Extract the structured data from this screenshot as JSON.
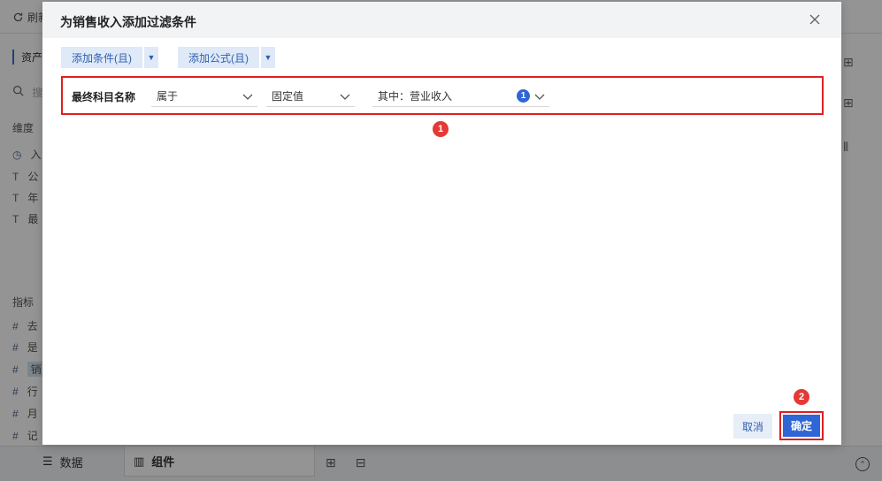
{
  "background": {
    "toolbar": {
      "refresh_label": "刷新"
    },
    "left_panel": {
      "title": "资产",
      "search_placeholder": "搜",
      "dimension_section": "维度",
      "dimension_items": [
        {
          "type_icon": "clock-icon",
          "label": "入"
        },
        {
          "type_icon": "text-type-icon",
          "label": "公"
        },
        {
          "type_icon": "text-type-icon",
          "label": "年"
        },
        {
          "type_icon": "text-type-icon",
          "label": "最"
        }
      ],
      "metric_section": "指标",
      "metric_items": [
        {
          "type_icon": "hash-icon",
          "label": "去"
        },
        {
          "type_icon": "hash-icon",
          "label": "是"
        },
        {
          "type_icon": "hash-icon",
          "label": "销"
        },
        {
          "type_icon": "hash-icon",
          "label": "行"
        },
        {
          "type_icon": "hash-icon",
          "label": "月"
        },
        {
          "type_icon": "hash-formula-icon",
          "label": "记"
        }
      ]
    },
    "bottom_tabs": [
      {
        "icon": "database-icon",
        "label": "数据"
      },
      {
        "icon": "component-icon",
        "label": "组件"
      }
    ]
  },
  "dialog": {
    "title": "为销售收入添加过滤条件",
    "add_condition_label": "添加条件(且)",
    "add_formula_label": "添加公式(且)",
    "condition": {
      "field": "最终科目名称",
      "operator": "属于",
      "value_type": "固定值",
      "value": "其中：营业收入",
      "value_count": "1"
    },
    "markers": [
      "1",
      "2"
    ],
    "cancel_label": "取消",
    "ok_label": "确定"
  },
  "colors": {
    "primary": "#2f66d6",
    "highlight_border": "#e02020",
    "marker": "#e53935",
    "soft_button": "#dfe9f7"
  }
}
